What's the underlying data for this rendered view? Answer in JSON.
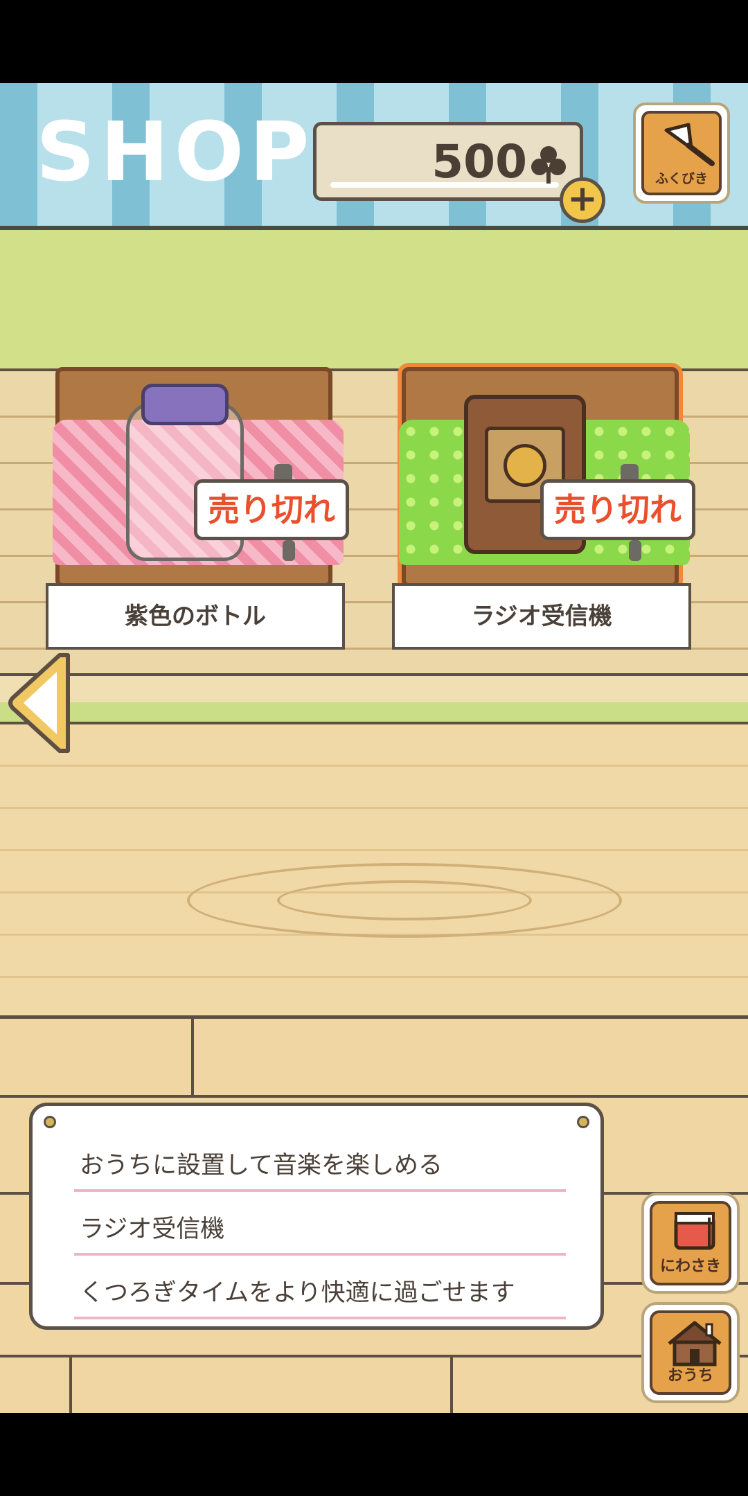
{
  "header": {
    "title": "SHOP",
    "clover_count": "500",
    "plus_label": "+",
    "lottery_label": "ふくびき"
  },
  "items": [
    {
      "name": "紫色のボトル",
      "status": "売り切れ",
      "selected": false
    },
    {
      "name": "ラジオ受信機",
      "status": "売り切れ",
      "selected": true
    }
  ],
  "description": {
    "line1": "おうちに設置して音楽を楽しめる",
    "line2": "ラジオ受信機",
    "line3": "くつろぎタイムをより快適に過ごせます"
  },
  "nav": {
    "garden_label": "にわさき",
    "home_label": "おうち"
  },
  "colors": {
    "accent_orange": "#f08a3a",
    "sold_red": "#e8502e",
    "header_blue": "#7fc0d4",
    "wall_green": "#d2e189"
  },
  "icons": {
    "clover": "clover-icon",
    "lottery": "bell-icon",
    "garden": "mailbox-icon",
    "home": "house-icon",
    "back": "left-arrow-icon"
  }
}
